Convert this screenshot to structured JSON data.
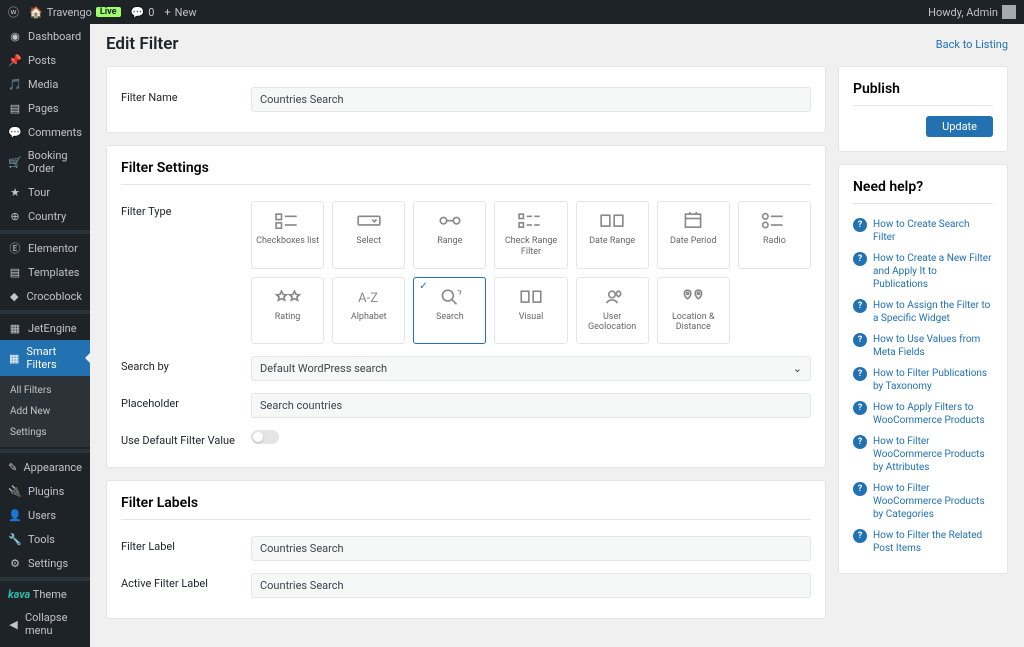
{
  "topbar": {
    "site": "Travengo",
    "live": "Live",
    "comments": "0",
    "new": "New",
    "howdy": "Howdy, Admin"
  },
  "sidebar": {
    "items": [
      {
        "icon": "gauge",
        "label": "Dashboard"
      },
      {
        "icon": "pin",
        "label": "Posts"
      },
      {
        "icon": "media",
        "label": "Media"
      },
      {
        "icon": "page",
        "label": "Pages"
      },
      {
        "icon": "comment",
        "label": "Comments"
      },
      {
        "icon": "cart",
        "label": "Booking Order"
      },
      {
        "icon": "star",
        "label": "Tour"
      },
      {
        "icon": "globe",
        "label": "Country"
      }
    ],
    "items2": [
      {
        "icon": "elem",
        "label": "Elementor"
      },
      {
        "icon": "page",
        "label": "Templates"
      },
      {
        "icon": "croco",
        "label": "Crocoblock"
      }
    ],
    "items3": [
      {
        "icon": "jet",
        "label": "JetEngine"
      },
      {
        "icon": "jet",
        "label": "Smart Filters",
        "active": true
      }
    ],
    "sub": [
      "All Filters",
      "Add New",
      "Settings"
    ],
    "items4": [
      {
        "icon": "brush",
        "label": "Appearance"
      },
      {
        "icon": "plug",
        "label": "Plugins"
      },
      {
        "icon": "user",
        "label": "Users"
      },
      {
        "icon": "tool",
        "label": "Tools"
      },
      {
        "icon": "gear",
        "label": "Settings"
      }
    ],
    "theme": {
      "brand": "kava",
      "label": "Theme"
    },
    "collapse": "Collapse menu"
  },
  "page": {
    "title": "Edit Filter",
    "back": "Back to Listing"
  },
  "filter": {
    "name_label": "Filter Name",
    "name": "Countries Search",
    "settings_heading": "Filter Settings",
    "type_label": "Filter Type",
    "types": [
      {
        "id": "checkboxes",
        "label": "Checkboxes list"
      },
      {
        "id": "select",
        "label": "Select"
      },
      {
        "id": "range",
        "label": "Range"
      },
      {
        "id": "checkrange",
        "label": "Check Range Filter"
      },
      {
        "id": "daterange",
        "label": "Date Range"
      },
      {
        "id": "dateperiod",
        "label": "Date Period"
      },
      {
        "id": "radio",
        "label": "Radio"
      },
      {
        "id": "rating",
        "label": "Rating"
      },
      {
        "id": "alphabet",
        "label": "Alphabet"
      },
      {
        "id": "search",
        "label": "Search",
        "selected": true
      },
      {
        "id": "visual",
        "label": "Visual"
      },
      {
        "id": "geo",
        "label": "User Geolocation"
      },
      {
        "id": "loc",
        "label": "Location & Distance"
      }
    ],
    "searchby_label": "Search by",
    "searchby": "Default WordPress search",
    "placeholder_label": "Placeholder",
    "placeholder": "Search countries",
    "default_label": "Use Default Filter Value",
    "labels_heading": "Filter Labels",
    "label_label": "Filter Label",
    "label_value": "Countries Search",
    "active_label": "Active Filter Label",
    "active_value": "Countries Search"
  },
  "publish": {
    "heading": "Publish",
    "update": "Update"
  },
  "help": {
    "heading": "Need help?",
    "items": [
      "How to Create Search Filter",
      "How to Create a New Filter and Apply It to Publications",
      "How to Assign the Filter to a Specific Widget",
      "How to Use Values from Meta Fields",
      "How to Filter Publications by Taxonomy",
      "How to Apply Filters to WooCommerce Products",
      "How to Filter WooCommerce Products by Attributes",
      "How to Filter WooCommerce Products by Categories",
      "How to Filter the Related Post Items"
    ]
  }
}
